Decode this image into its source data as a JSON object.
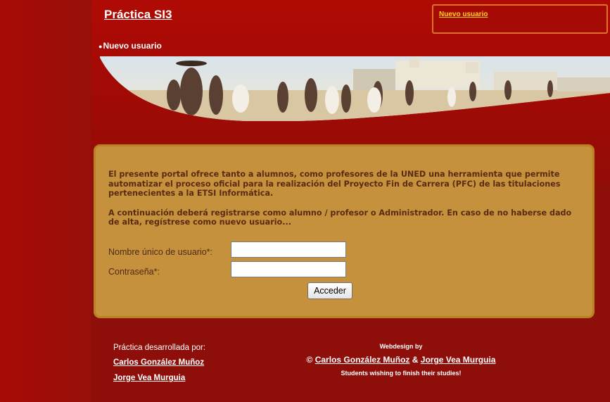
{
  "header": {
    "site_title": "Práctica SI3",
    "top_link": "Nuevo usuario",
    "nav_item": "Nuevo usuario"
  },
  "intro": {
    "paragraph1": "El presente portal ofrece tanto a alumnos, como profesores de la UNED una herramienta que permite automatizar el proceso oficial para la realización del Proyecto Fin de Carrera (PFC) de las titulaciones pertenecientes a la ETSI Informática.",
    "paragraph2": "A continuación deberá registrarse como alumno / profesor o Administrador. En caso de no haberse dado de alta, regístrese como nuevo usuario..."
  },
  "login_form": {
    "username_label": "Nombre único de usuario*:",
    "username_value": "",
    "password_label": "Contraseña*:",
    "password_value": "",
    "submit_label": "Acceder"
  },
  "footer": {
    "developed_by_label": "Práctica desarrollada por:",
    "author1": "Carlos González Muñoz",
    "author2": "Jorge Vea Murguia",
    "webdesign_label": "Webdesign by",
    "copyright_symbol": "©",
    "design_author1": "Carlos González Muñoz",
    "ampersand": "&",
    "design_author2": "Jorge Vea Murguia",
    "tagline": "Students wishing to finish their studies!"
  },
  "colors": {
    "background": "#8e0f0a",
    "box_fill": "#c5913c",
    "box_border": "#b8821e",
    "link_yellow": "#ffd21a",
    "box_text": "#5a2b10"
  }
}
